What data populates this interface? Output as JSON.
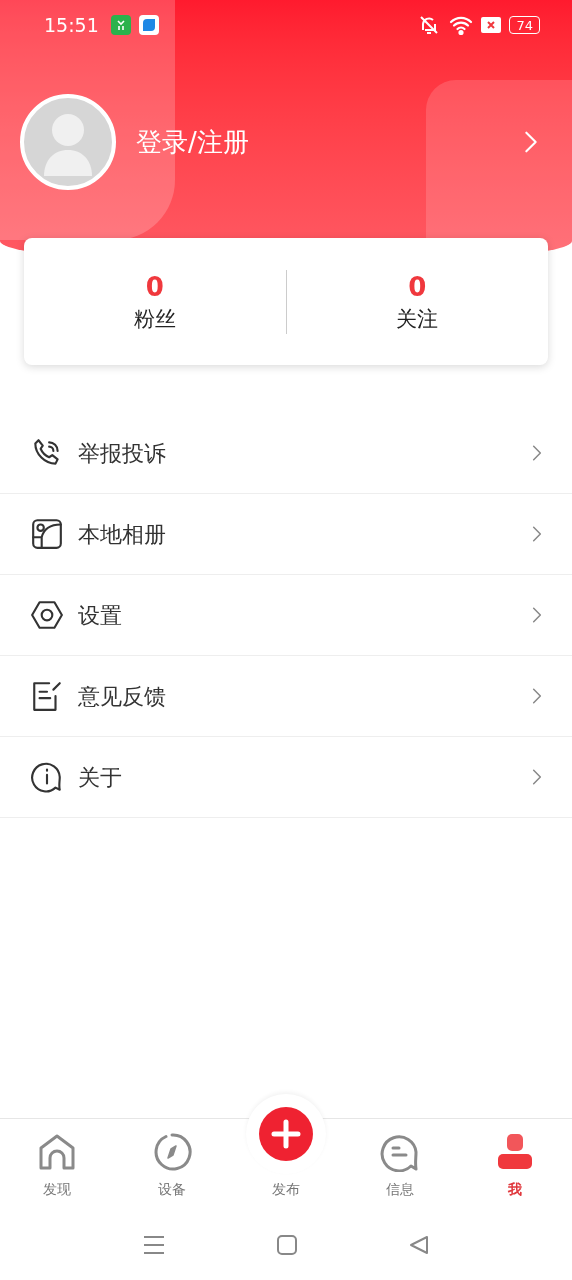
{
  "status_bar": {
    "time": "15:51",
    "battery": "74"
  },
  "profile": {
    "login_label": "登录/注册"
  },
  "stats": [
    {
      "value": "0",
      "label": "粉丝"
    },
    {
      "value": "0",
      "label": "关注"
    }
  ],
  "menu": [
    {
      "kind": "phone",
      "label": "举报投诉"
    },
    {
      "kind": "album",
      "label": "本地相册"
    },
    {
      "kind": "settings",
      "label": "设置"
    },
    {
      "kind": "feedback",
      "label": "意见反馈"
    },
    {
      "kind": "info",
      "label": "关于"
    }
  ],
  "tabs": [
    {
      "kind": "home",
      "label": "发现",
      "selected": false
    },
    {
      "kind": "compass",
      "label": "设备",
      "selected": false
    },
    {
      "kind": "publish",
      "label": "发布",
      "selected": false
    },
    {
      "kind": "message",
      "label": "信息",
      "selected": false
    },
    {
      "kind": "person",
      "label": "我",
      "selected": true
    }
  ]
}
